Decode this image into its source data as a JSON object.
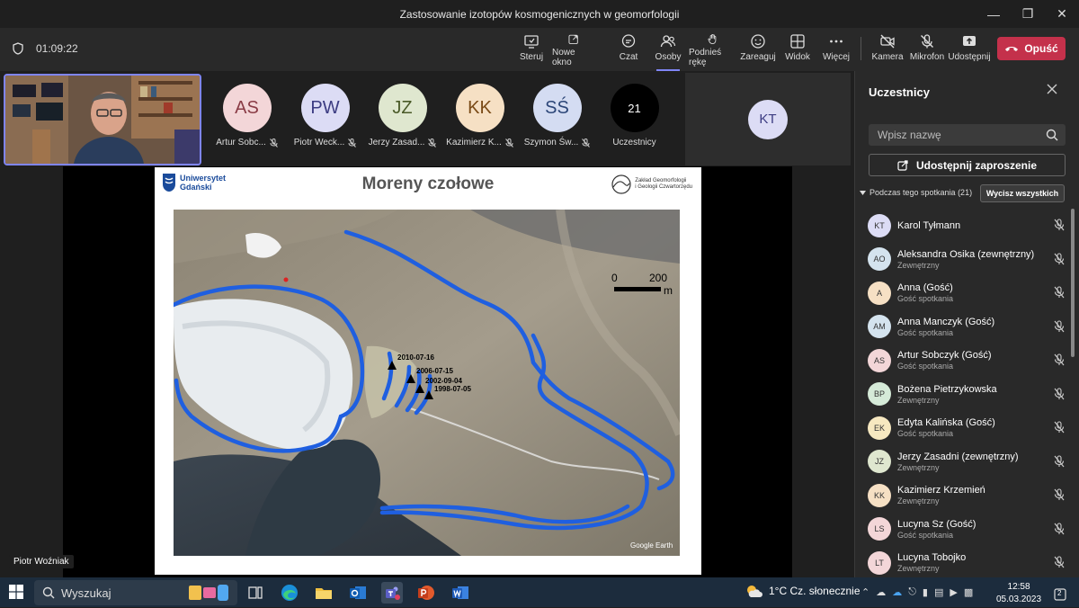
{
  "window": {
    "title": "Zastosowanie izotopów kosmogenicznych w geomorfologii"
  },
  "toolbar": {
    "timer": "01:09:22",
    "buttons": [
      {
        "label": "Steruj",
        "icon": "share-screen-icon"
      },
      {
        "label": "Nowe okno",
        "icon": "popout-icon"
      },
      {
        "label": "Czat",
        "icon": "chat-icon"
      },
      {
        "label": "Osoby",
        "icon": "people-icon"
      },
      {
        "label": "Podnieś rękę",
        "icon": "raise-hand-icon"
      },
      {
        "label": "Zareaguj",
        "icon": "smiley-icon"
      },
      {
        "label": "Widok",
        "icon": "grid-icon"
      },
      {
        "label": "Więcej",
        "icon": "more-icon"
      },
      {
        "label": "Kamera",
        "icon": "camera-off-icon"
      },
      {
        "label": "Mikrofon",
        "icon": "mic-off-icon"
      },
      {
        "label": "Udostępnij",
        "icon": "upload-icon"
      }
    ],
    "leave_label": "Opuść"
  },
  "strip": {
    "participants": [
      {
        "initials": "AS",
        "name": "Artur Sobc...",
        "color": "#f3d6d8"
      },
      {
        "initials": "PW",
        "name": "Piotr Weck...",
        "color": "#dcdcf5"
      },
      {
        "initials": "JZ",
        "name": "Jerzy Zasad...",
        "color": "#dfe7cf"
      },
      {
        "initials": "KK",
        "name": "Kazimierz K...",
        "color": "#f6e0c4"
      },
      {
        "initials": "SŚ",
        "name": "Szymon Św...",
        "color": "#d4dcf2"
      }
    ],
    "overflow_count": "21",
    "overflow_label": "Uczestnicy",
    "tile_initials": "KT"
  },
  "slide": {
    "title": "Moreny czołowe",
    "logo_left": "Uniwersytet\nGdański",
    "logo_right": "Zakład Geomorfologii\ni Geologii Czwartorzędu",
    "scale_0": "0",
    "scale_200": "200",
    "scale_unit": "m",
    "dates": [
      "2010-07-16",
      "2006-07-15",
      "2002-09-04",
      "1998-07-05"
    ],
    "credit": "Google Earth"
  },
  "presenter": "Piotr Woźniak",
  "panel": {
    "title": "Uczestnicy",
    "search_placeholder": "Wpisz nazwę",
    "share_label": "Udostępnij zaproszenie",
    "section_label": "Podczas tego spotkania (21)",
    "mute_all": "Wycisz wszystkich",
    "people": [
      {
        "initials": "KT",
        "name": "Karol Tyłmann",
        "sub": "",
        "color": "#dcdcf5"
      },
      {
        "initials": "AO",
        "name": "Aleksandra Osika (zewnętrzny)",
        "sub": "Zewnętrzny",
        "color": "#d4e3ee"
      },
      {
        "initials": "A",
        "name": "Anna (Gość)",
        "sub": "Gość spotkania",
        "color": "#f6e0c4"
      },
      {
        "initials": "AM",
        "name": "Anna Manczyk (Gość)",
        "sub": "Gość spotkania",
        "color": "#d4e3ee"
      },
      {
        "initials": "AS",
        "name": "Artur Sobczyk (Gość)",
        "sub": "Gość spotkania",
        "color": "#f3d6d8"
      },
      {
        "initials": "BP",
        "name": "Bożena Pietrzykowska",
        "sub": "Zewnętrzny",
        "color": "#d5ead8"
      },
      {
        "initials": "EK",
        "name": "Edyta Kalińska (Gość)",
        "sub": "Gość spotkania",
        "color": "#f6e8c0"
      },
      {
        "initials": "JZ",
        "name": "Jerzy Zasadni (zewnętrzny)",
        "sub": "Zewnętrzny",
        "color": "#dfe7cf"
      },
      {
        "initials": "KK",
        "name": "Kazimierz Krzemień",
        "sub": "Zewnętrzny",
        "color": "#f6e0c4"
      },
      {
        "initials": "LS",
        "name": "Lucyna Sz (Gość)",
        "sub": "Gość spotkania",
        "color": "#f3d6d8"
      },
      {
        "initials": "LT",
        "name": "Lucyna Tobojko",
        "sub": "Zewnętrzny",
        "color": "#f3d6d8"
      }
    ]
  },
  "taskbar": {
    "search_label": "Wyszukaj",
    "weather": "1°C  Cz. słonecznie",
    "time": "12:58",
    "date": "05.03.2023",
    "notifications": "2"
  }
}
